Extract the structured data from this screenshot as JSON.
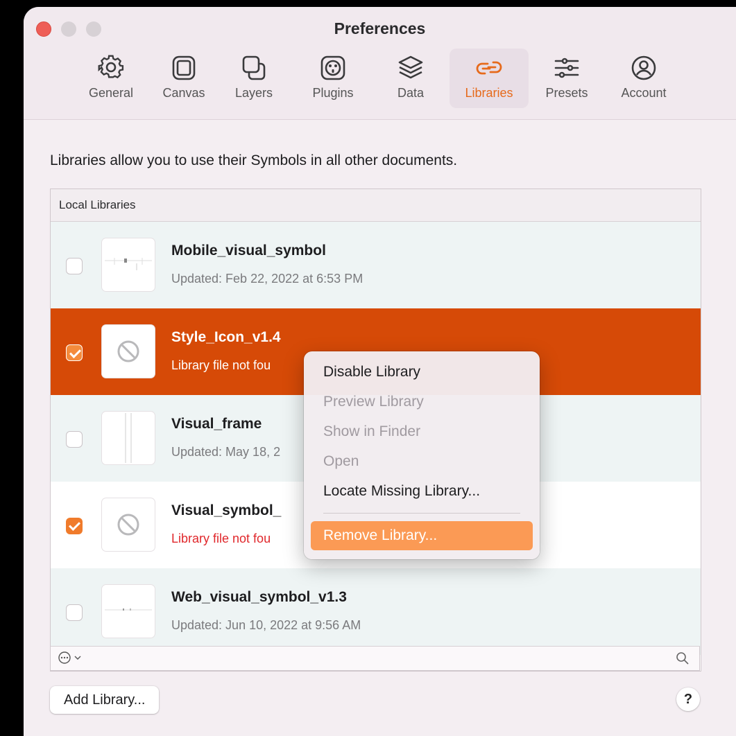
{
  "window": {
    "title": "Preferences"
  },
  "toolbar": [
    {
      "label": "General",
      "icon": "gear-icon",
      "active": false
    },
    {
      "label": "Canvas",
      "icon": "canvas-icon",
      "active": false
    },
    {
      "label": "Layers",
      "icon": "layers-icon",
      "active": false
    },
    {
      "label": "Plugins",
      "icon": "plugin-icon",
      "active": false
    },
    {
      "label": "Data",
      "icon": "data-stack-icon",
      "active": false
    },
    {
      "label": "Libraries",
      "icon": "link-icon",
      "active": true
    },
    {
      "label": "Presets",
      "icon": "sliders-icon",
      "active": false
    },
    {
      "label": "Account",
      "icon": "account-icon",
      "active": false
    }
  ],
  "description": "Libraries allow you to use their Symbols in all other documents.",
  "list": {
    "header": "Local Libraries",
    "rows": [
      {
        "title": "Mobile_visual_symbol",
        "subtitle": "Updated: Feb 22, 2022 at 6:53 PM",
        "checked": false
      },
      {
        "title": "Style_Icon_v1.4",
        "subtitle": "Library file not fou",
        "checked": true
      },
      {
        "title": "Visual_frame",
        "subtitle": "Updated: May 18, 2",
        "checked": false
      },
      {
        "title": "Visual_symbol_",
        "subtitle": "Library file not fou",
        "checked": true
      },
      {
        "title": "Web_visual_symbol_v1.3",
        "subtitle": "Updated: Jun 10, 2022 at 9:56 AM",
        "checked": false
      }
    ]
  },
  "bottom_bar": {
    "options_icon": "ellipsis-circle-icon",
    "search_icon": "search-icon"
  },
  "buttons": {
    "add_library": "Add Library...",
    "help": "?"
  },
  "context_menu": {
    "items": [
      {
        "label": "Disable Library",
        "enabled": true
      },
      {
        "label": "Preview Library",
        "enabled": false
      },
      {
        "label": "Show in Finder",
        "enabled": false
      },
      {
        "label": "Open",
        "enabled": false
      },
      {
        "label": "Locate Missing Library...",
        "enabled": true
      },
      {
        "label": "Remove Library...",
        "enabled": true,
        "highlighted": true
      }
    ]
  },
  "colors": {
    "accent": "#e66a1b",
    "selected_row": "#d64a07",
    "menu_highlight": "#fb9a55",
    "error_text": "#e0272b"
  }
}
